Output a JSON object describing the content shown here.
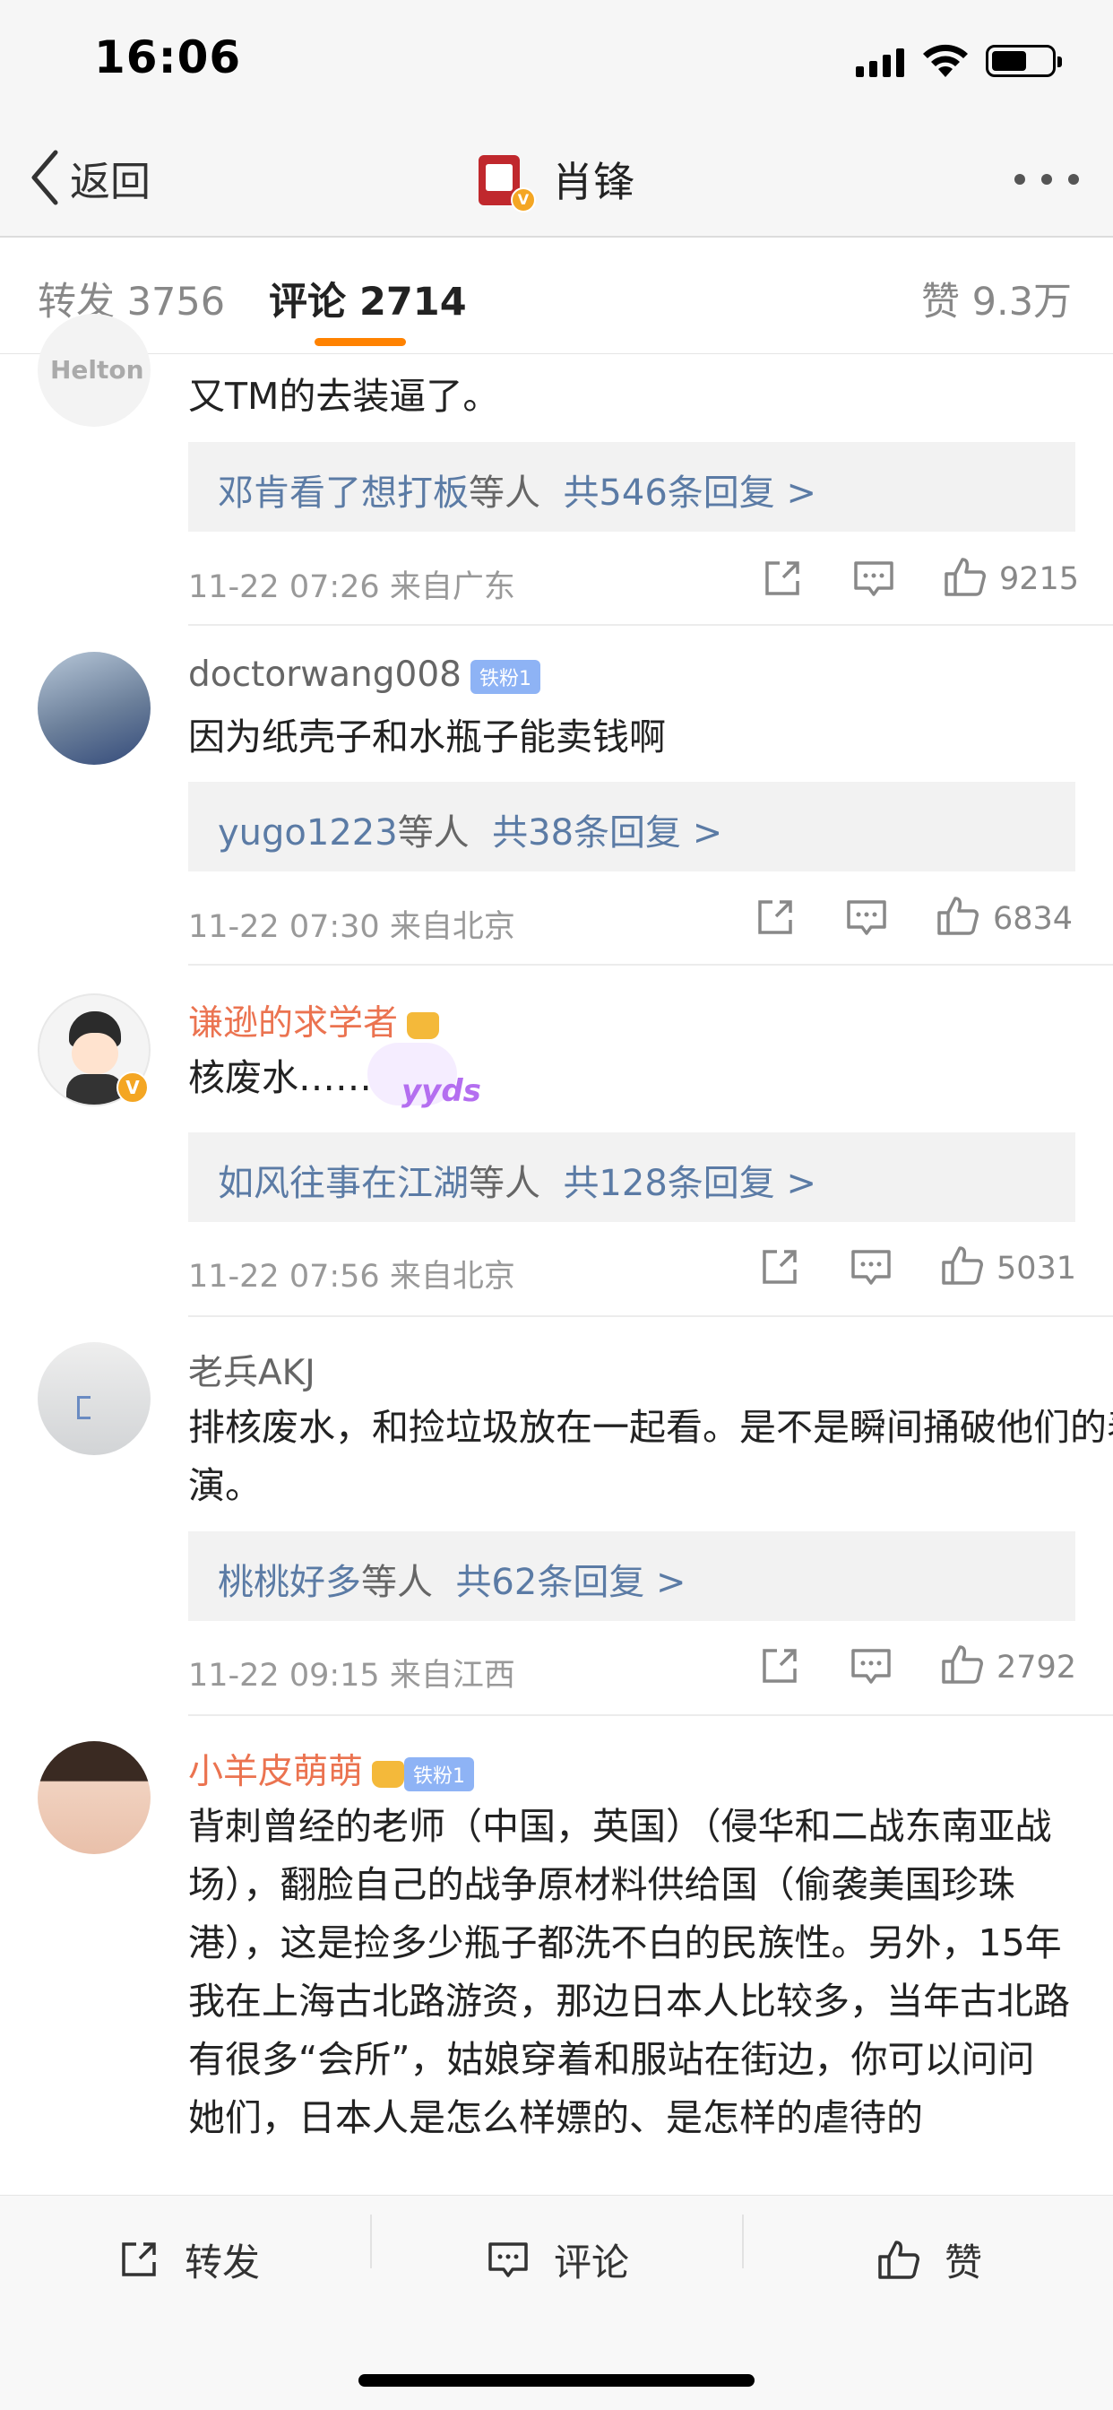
{
  "status_bar": {
    "time": "16:06"
  },
  "nav": {
    "back_label": "返回",
    "title": "肖锋",
    "verified_mark": "V"
  },
  "tabs": {
    "repost": "转发 3756",
    "comments": "评论 2714",
    "likes": "赞 9.3万"
  },
  "comments": [
    {
      "avatar_text": "Helton",
      "text": "又TM的去装逼了。",
      "reply_who": "邓肯看了想打板",
      "reply_by": "等人",
      "reply_total": "共546条回复 >",
      "time": "11-22 07:26 来自广东",
      "likes": "9215"
    },
    {
      "username": "doctorwang008",
      "badge": "铁粉1",
      "text": "因为纸壳子和水瓶子能卖钱啊",
      "reply_who": "yugo1223",
      "reply_by": "等人",
      "reply_total": "共38条回复 >",
      "time": "11-22 07:30 来自北京",
      "likes": "6834"
    },
    {
      "username": "谦逊的求学者",
      "text": "核废水……",
      "sticker": "yyds",
      "reply_who": "如风往事在江湖",
      "reply_by": "等人",
      "reply_total": "共128条回复 >",
      "time": "11-22 07:56 来自北京",
      "likes": "5031"
    },
    {
      "username": "老兵AKJ",
      "text": "排核废水，和捡垃圾放在一起看。是不是瞬间捅破他们的表演。",
      "reply_who": "桃桃好多",
      "reply_by": "等人",
      "reply_total": "共62条回复 >",
      "time": "11-22 09:15 来自江西",
      "likes": "2792"
    },
    {
      "username": "小羊皮萌萌",
      "badge": "铁粉1",
      "text": "背刺曾经的老师（中国，英国）（侵华和二战东南亚战场），翻脸自己的战争原材料供给国（偷袭美国珍珠港），这是捡多少瓶子都洗不白的民族性。另外，15年我在上海古北路游资，那边日本人比较多，当年古北路有很多“会所”，姑娘穿着和服站在街边，你可以问问她们，日本人是怎么样嫖的、是怎样的虐待的"
    }
  ],
  "bottom_bar": {
    "repost": "转发",
    "comment": "评论",
    "like": "赞"
  },
  "colors": {
    "accent": "#ff8200",
    "link": "#5b7ba5",
    "vip_name": "#eb7350"
  }
}
